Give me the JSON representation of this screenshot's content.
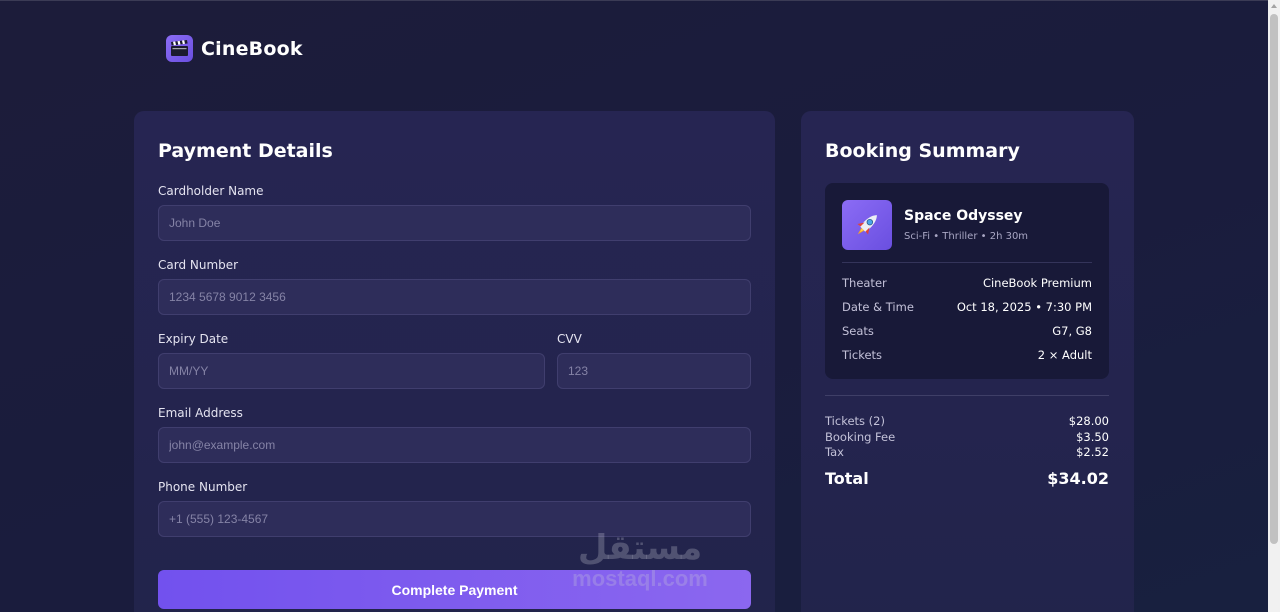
{
  "brand": {
    "name": "CineBook",
    "logo_icon": "clapperboard-icon"
  },
  "payment": {
    "title": "Payment Details",
    "fields": {
      "cardholder": {
        "label": "Cardholder Name",
        "placeholder": "John Doe",
        "value": ""
      },
      "card_number": {
        "label": "Card Number",
        "placeholder": "1234 5678 9012 3456",
        "value": ""
      },
      "expiry": {
        "label": "Expiry Date",
        "placeholder": "MM/YY",
        "value": ""
      },
      "cvv": {
        "label": "CVV",
        "placeholder": "123",
        "value": ""
      },
      "email": {
        "label": "Email Address",
        "placeholder": "john@example.com",
        "value": ""
      },
      "phone": {
        "label": "Phone Number",
        "placeholder": "+1 (555) 123-4567",
        "value": ""
      }
    },
    "submit_label": "Complete Payment"
  },
  "summary": {
    "title": "Booking Summary",
    "movie": {
      "title": "Space Odyssey",
      "meta": "Sci-Fi • Thriller • 2h 30m",
      "poster_icon": "rocket-icon"
    },
    "details": [
      {
        "label": "Theater",
        "value": "CineBook Premium"
      },
      {
        "label": "Date & Time",
        "value": "Oct 18, 2025 • 7:30 PM"
      },
      {
        "label": "Seats",
        "value": "G7, G8"
      },
      {
        "label": "Tickets",
        "value": "2 × Adult"
      }
    ],
    "prices": [
      {
        "label": "Tickets (2)",
        "value": "$28.00"
      },
      {
        "label": "Booking Fee",
        "value": "$3.50"
      },
      {
        "label": "Tax",
        "value": "$2.52"
      }
    ],
    "total": {
      "label": "Total",
      "value": "$34.02"
    }
  },
  "watermark": {
    "arabic": "مستقل",
    "latin": "mostaql.com"
  },
  "colors": {
    "background": "#1c1c3a",
    "panel": "#262552",
    "card": "#181938",
    "input_bg": "#2e2d5a",
    "accent": "#7251ee",
    "accent_light": "#8b67ef"
  }
}
